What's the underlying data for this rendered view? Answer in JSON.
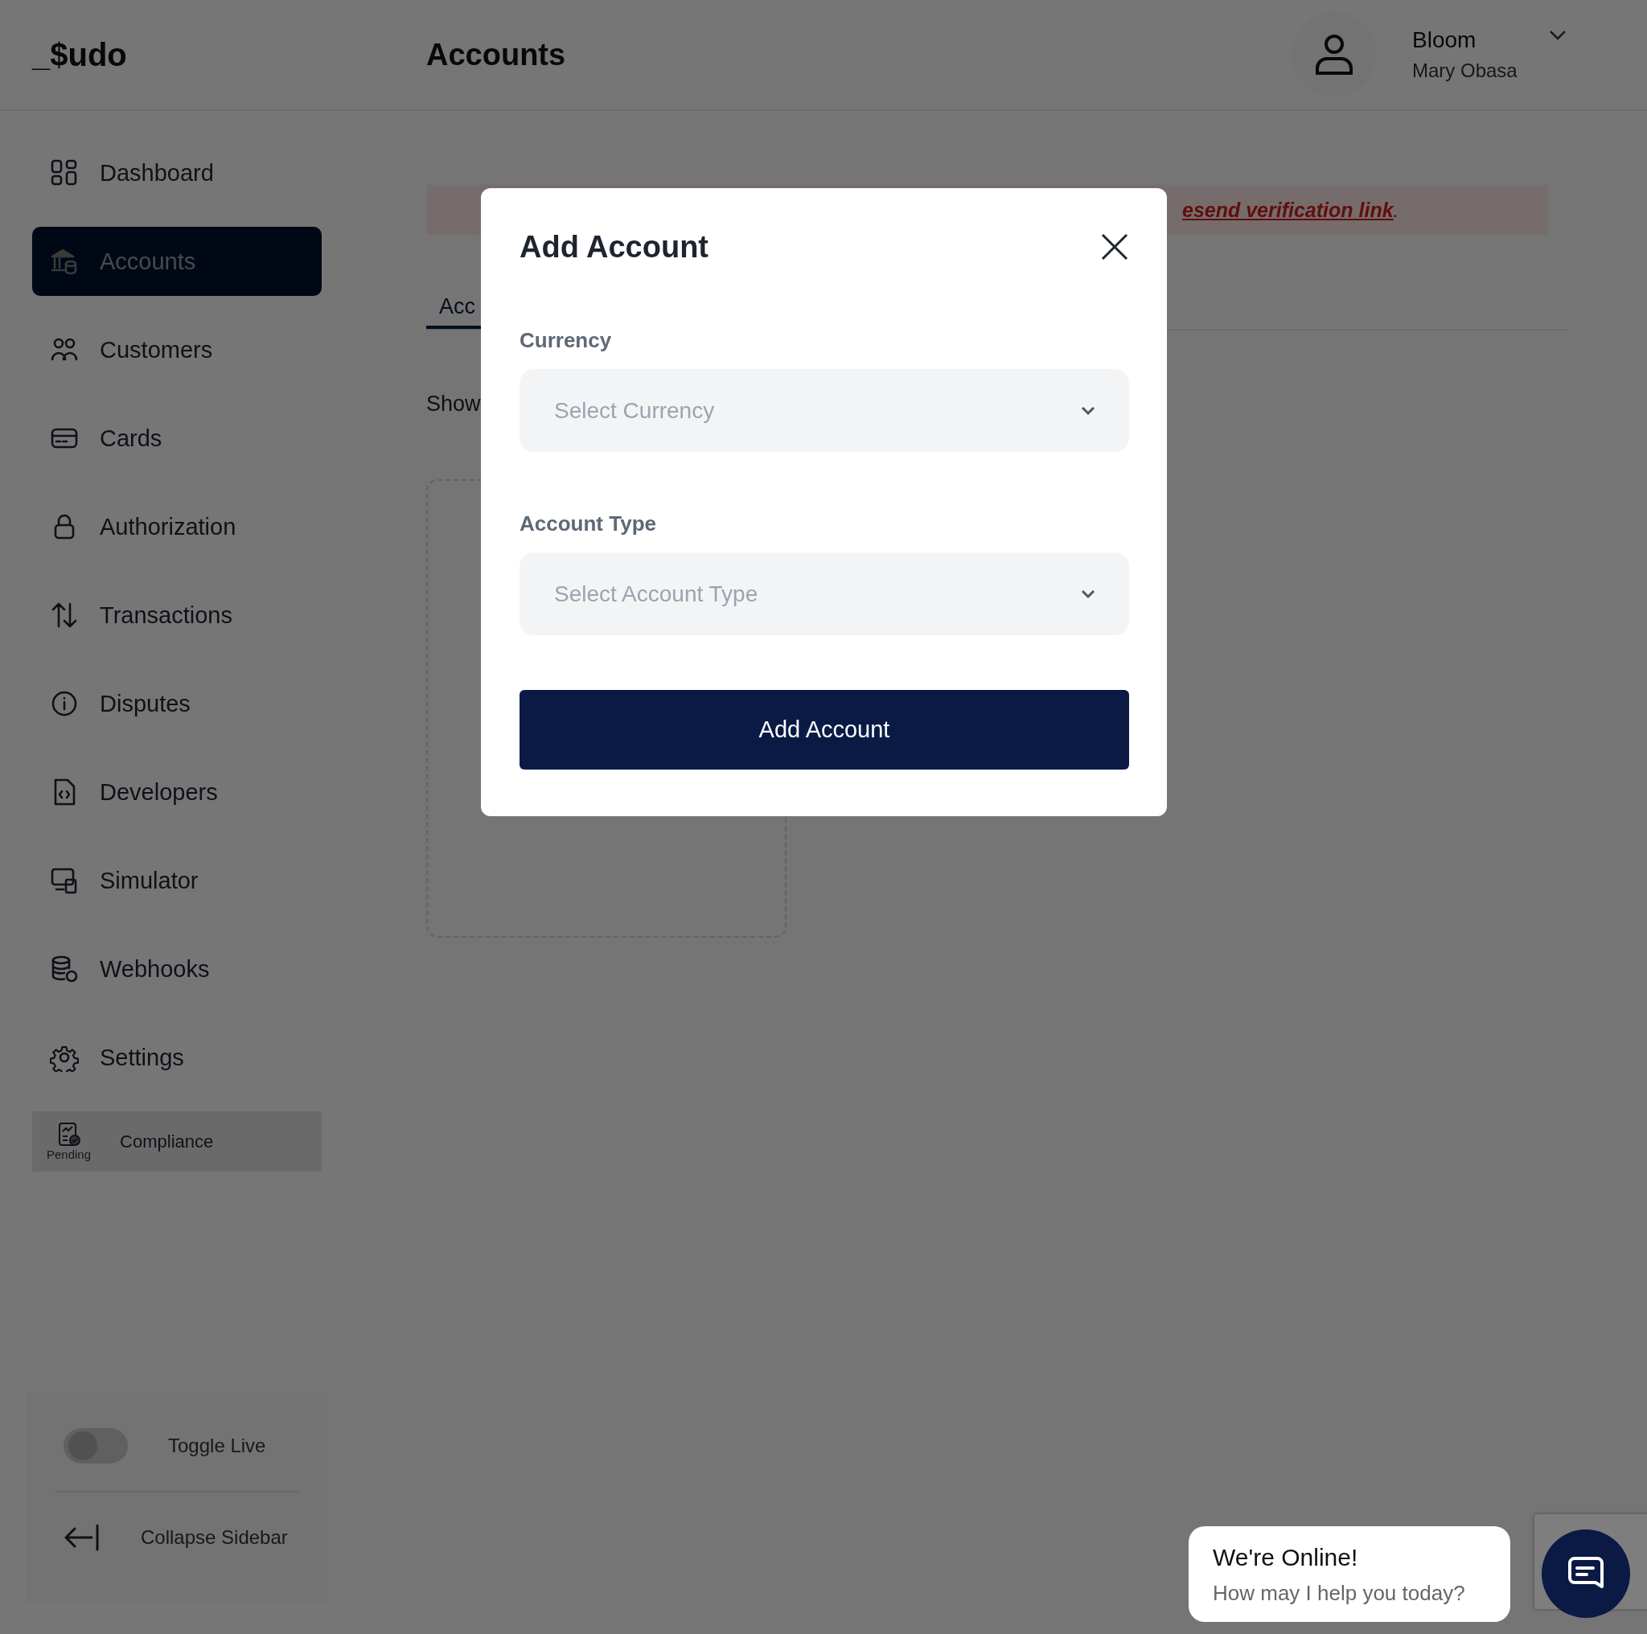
{
  "header": {
    "logo": "_$udo",
    "title": "Accounts",
    "user": {
      "business": "Bloom",
      "name": "Mary Obasa"
    }
  },
  "sidebar": {
    "items": [
      {
        "label": "Dashboard",
        "selected": false
      },
      {
        "label": "Accounts",
        "selected": true
      },
      {
        "label": "Customers",
        "selected": false
      },
      {
        "label": "Cards",
        "selected": false
      },
      {
        "label": "Authorization",
        "selected": false
      },
      {
        "label": "Transactions",
        "selected": false
      },
      {
        "label": "Disputes",
        "selected": false
      },
      {
        "label": "Developers",
        "selected": false
      },
      {
        "label": "Simulator",
        "selected": false
      },
      {
        "label": "Webhooks",
        "selected": false
      },
      {
        "label": "Settings",
        "selected": false
      }
    ],
    "compliance": {
      "label": "Compliance",
      "badge": "Pending"
    },
    "toggle_live": {
      "label": "Toggle Live",
      "on": false
    },
    "collapse": {
      "label": "Collapse Sidebar"
    }
  },
  "main": {
    "banner": {
      "link": "esend verification link",
      "tail": "."
    },
    "tab": "Acc",
    "show_label": "Show"
  },
  "modal": {
    "title": "Add Account",
    "fields": [
      {
        "label": "Currency",
        "placeholder": "Select Currency"
      },
      {
        "label": "Account Type",
        "placeholder": "Select Account Type"
      }
    ],
    "button": "Add Account"
  },
  "chat": {
    "title": "We're Online!",
    "subtitle": "How may I help you today?"
  }
}
